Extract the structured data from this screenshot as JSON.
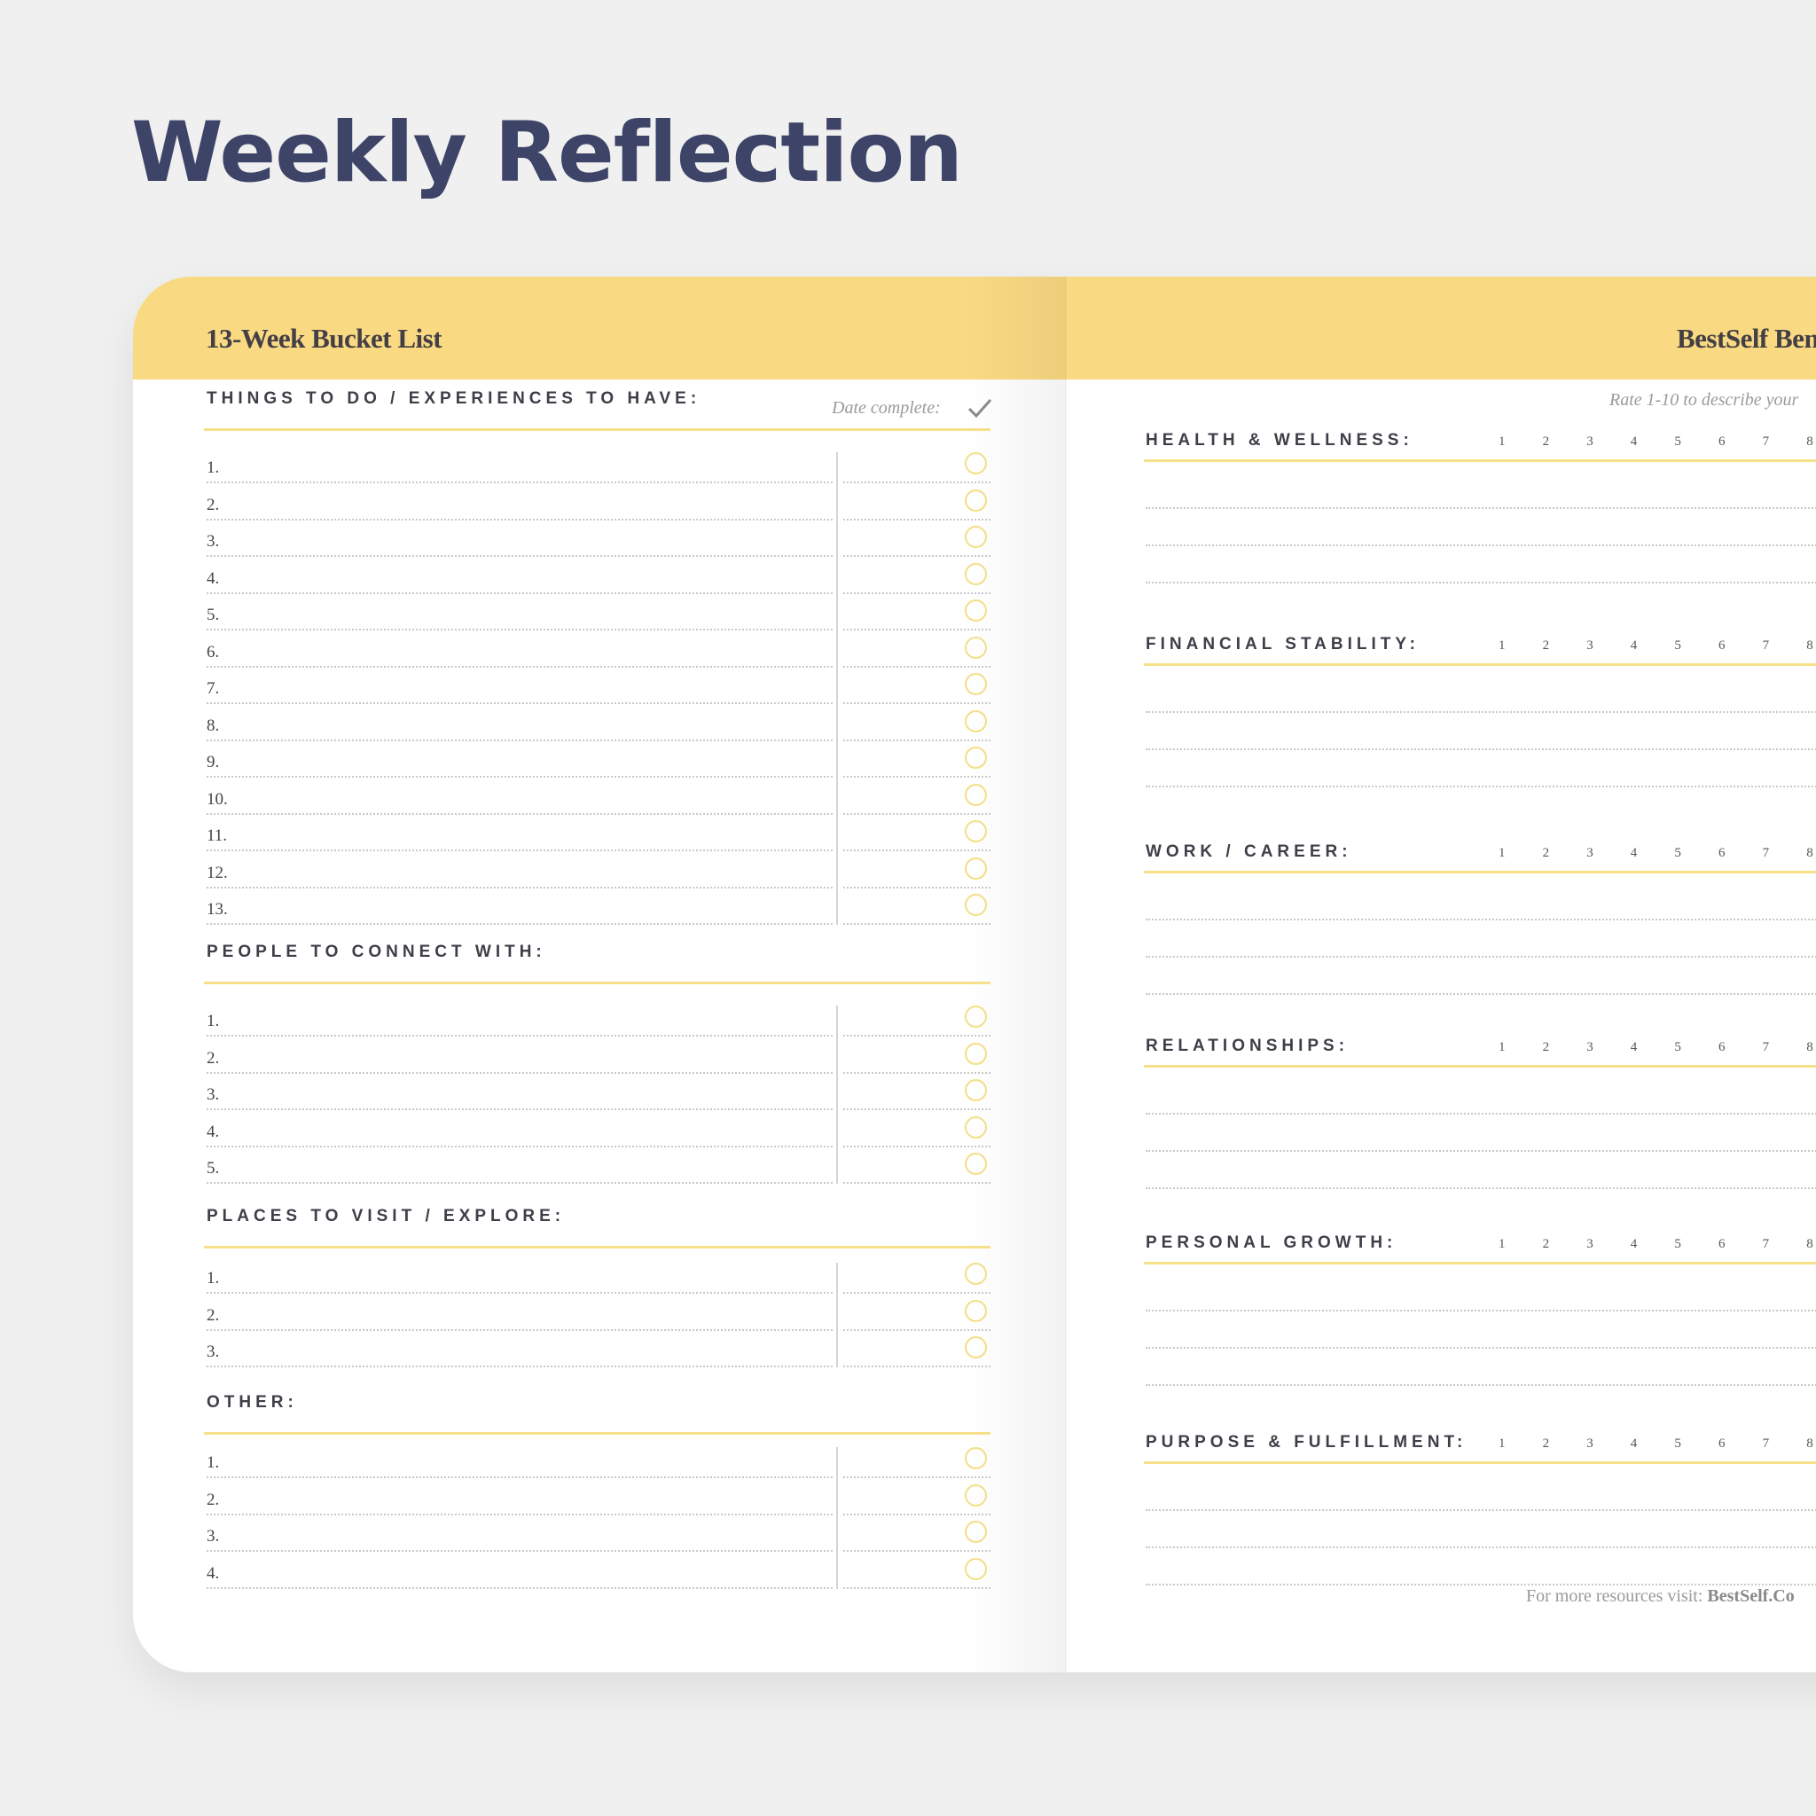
{
  "page_title": "Weekly Reflection",
  "left_page": {
    "header": "13-Week Bucket List",
    "date_complete_label": "Date complete:",
    "check_icon": "checkmark-icon",
    "accent_color": "#f9d982",
    "sections": [
      {
        "heading": "THINGS TO DO / EXPERIENCES TO HAVE:",
        "items": [
          "1.",
          "2.",
          "3.",
          "4.",
          "5.",
          "6.",
          "7.",
          "8.",
          "9.",
          "10.",
          "11.",
          "12.",
          "13."
        ]
      },
      {
        "heading": "PEOPLE TO CONNECT WITH:",
        "items": [
          "1.",
          "2.",
          "3.",
          "4.",
          "5."
        ]
      },
      {
        "heading": "PLACES TO VISIT / EXPLORE:",
        "items": [
          "1.",
          "2.",
          "3."
        ]
      },
      {
        "heading": "OTHER:",
        "items": [
          "1.",
          "2.",
          "3.",
          "4."
        ]
      }
    ]
  },
  "right_page": {
    "header": "BestSelf Ben",
    "rate_hint": "Rate 1-10 to describe your",
    "scale": [
      "1",
      "2",
      "3",
      "4",
      "5",
      "6",
      "7",
      "8"
    ],
    "sections": [
      {
        "heading": "HEALTH & WELLNESS:"
      },
      {
        "heading": "FINANCIAL STABILITY:"
      },
      {
        "heading": "WORK / CAREER:"
      },
      {
        "heading": "RELATIONSHIPS:"
      },
      {
        "heading": "PERSONAL GROWTH:"
      },
      {
        "heading": "PURPOSE & FULFILLMENT:"
      }
    ],
    "footer_text": "For more resources visit:",
    "footer_link": "BestSelf.Co"
  }
}
